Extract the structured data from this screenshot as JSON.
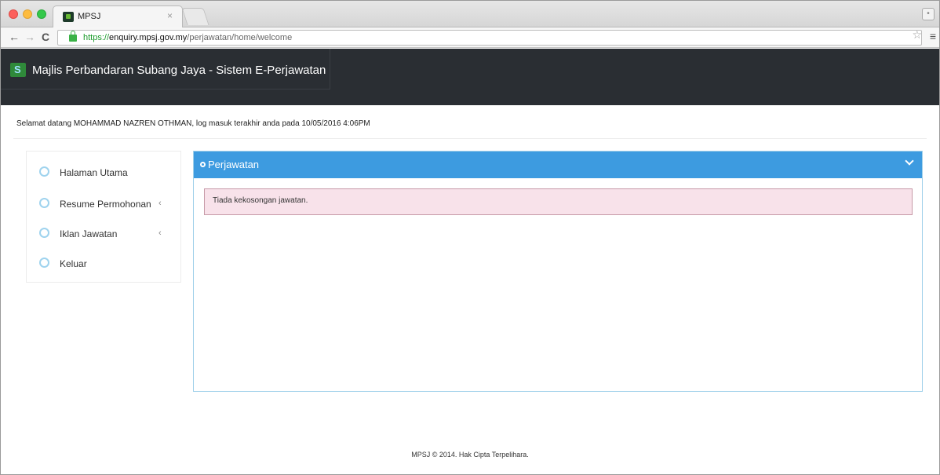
{
  "browser": {
    "tab_title": "MPSJ",
    "tab_close": "×",
    "url": {
      "protocol": "https://",
      "host": "enquiry.mpsj.gov.my",
      "path": "/perjawatan/home/welcome"
    }
  },
  "header": {
    "title": "Majlis Perbandaran Subang Jaya - Sistem E-Perjawatan"
  },
  "welcome_text": "Selamat datang MOHAMMAD NAZREN OTHMAN, log masuk terakhir anda pada 10/05/2016 4:06PM",
  "sidebar": {
    "items": [
      {
        "label": "Halaman Utama",
        "icon": "user-icon"
      },
      {
        "label": "Resume Permohonan",
        "icon": "gear-icon",
        "chevron": "‹"
      },
      {
        "label": "Iklan Jawatan",
        "icon": "globe-icon",
        "chevron": "‹"
      },
      {
        "label": "Keluar",
        "icon": "trophy-icon"
      }
    ]
  },
  "panel": {
    "title": "Perjawatan",
    "alert": "Tiada kekosongan jawatan."
  },
  "footer": {
    "text": "MPSJ © 2014. Hak Cipta Terpelihara."
  },
  "colors": {
    "header_bg": "#2a2e33",
    "panel_accent": "#3d9be0",
    "alert_bg": "#f8e2ea"
  }
}
